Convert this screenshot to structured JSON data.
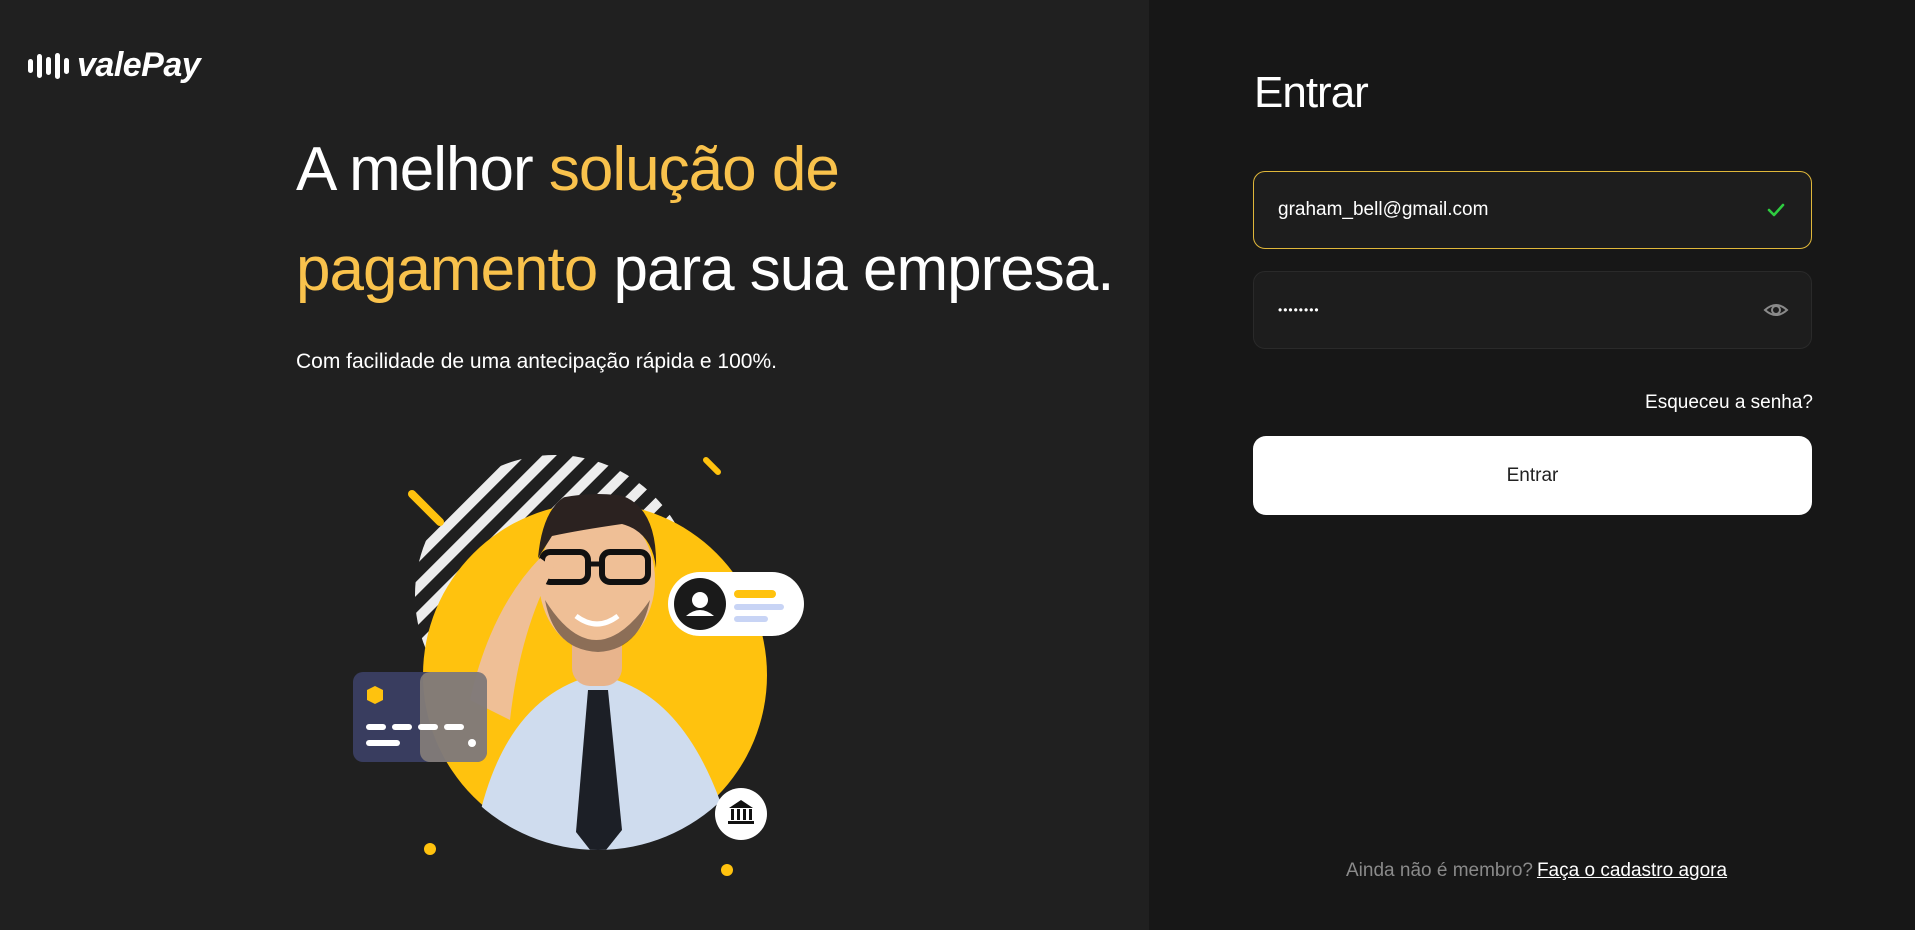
{
  "brand": {
    "name": "valePay",
    "icon": "sound-wave-logo-icon"
  },
  "hero": {
    "headline_part1": "A melhor ",
    "headline_highlight1": "solução de",
    "headline_highlight2": "pagamento",
    "headline_part2": " para sua empresa.",
    "subtext": "Com facilidade de uma antecipação rápida e 100%."
  },
  "login": {
    "title": "Entrar",
    "email_value": "graham_bell@gmail.com",
    "email_valid_icon": "check-icon",
    "password_value": "••••••••",
    "password_toggle_icon": "eye-icon",
    "forgot_label": "Esqueceu a senha?",
    "submit_label": "Entrar",
    "signup_prompt": "Ainda não é membro?",
    "signup_link": "Faça o cadastro agora"
  },
  "colors": {
    "accent": "#f9c24c",
    "yellow_graphic": "#ffc20e",
    "check": "#2ecc40",
    "bg_left": "#202020",
    "bg_right": "#171717"
  }
}
